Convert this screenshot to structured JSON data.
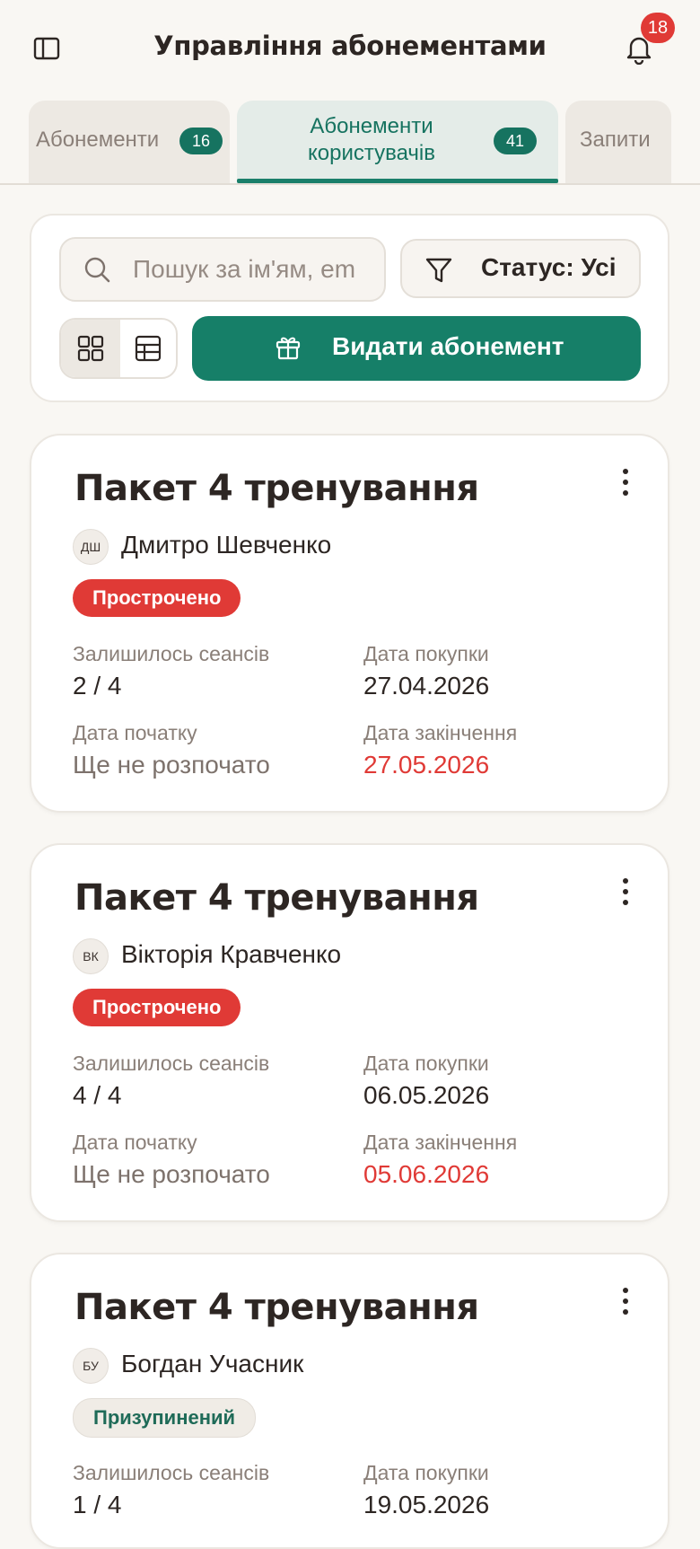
{
  "header": {
    "title": "Управління абонементами",
    "notifications_count": "18"
  },
  "tabs": [
    {
      "label": "Абонементи",
      "count": "16",
      "active": false
    },
    {
      "label": "Абонементи користувачів",
      "count": "41",
      "active": true
    },
    {
      "label": "Запити",
      "active": false
    }
  ],
  "toolbar": {
    "search_placeholder": "Пошук за ім'ям, em",
    "search_value": "",
    "status_filter_label": "Статус: Усі",
    "view_modes": [
      "grid",
      "table"
    ],
    "active_view": "grid",
    "issue_button_label": "Видати абонемент"
  },
  "field_labels": {
    "sessions_left": "Залишилось сеансів",
    "purchase_date": "Дата покупки",
    "start_date": "Дата початку",
    "end_date": "Дата закінчення"
  },
  "cards": [
    {
      "title": "Пакет 4 тренування",
      "user_initials": "ДШ",
      "user_name": "Дмитро Шевченко",
      "status": "Прострочено",
      "status_kind": "expired",
      "sessions_left": "2 / 4",
      "purchase_date": "27.04.2026",
      "start_date": "Ще не розпочато",
      "end_date": "27.05.2026"
    },
    {
      "title": "Пакет 4 тренування",
      "user_initials": "ВК",
      "user_name": "Вікторія Кравченко",
      "status": "Прострочено",
      "status_kind": "expired",
      "sessions_left": "4 / 4",
      "purchase_date": "06.05.2026",
      "start_date": "Ще не розпочато",
      "end_date": "05.06.2026"
    },
    {
      "title": "Пакет 4 тренування",
      "user_initials": "БУ",
      "user_name": "Богдан Учасник",
      "status": "Призупинений",
      "status_kind": "paused",
      "sessions_left": "1 / 4",
      "purchase_date": "19.05.2026"
    }
  ],
  "colors": {
    "accent": "#167f68",
    "danger": "#e03a36",
    "background": "#f9f7f3",
    "text": "#2d2623",
    "muted": "#8a7f78"
  }
}
